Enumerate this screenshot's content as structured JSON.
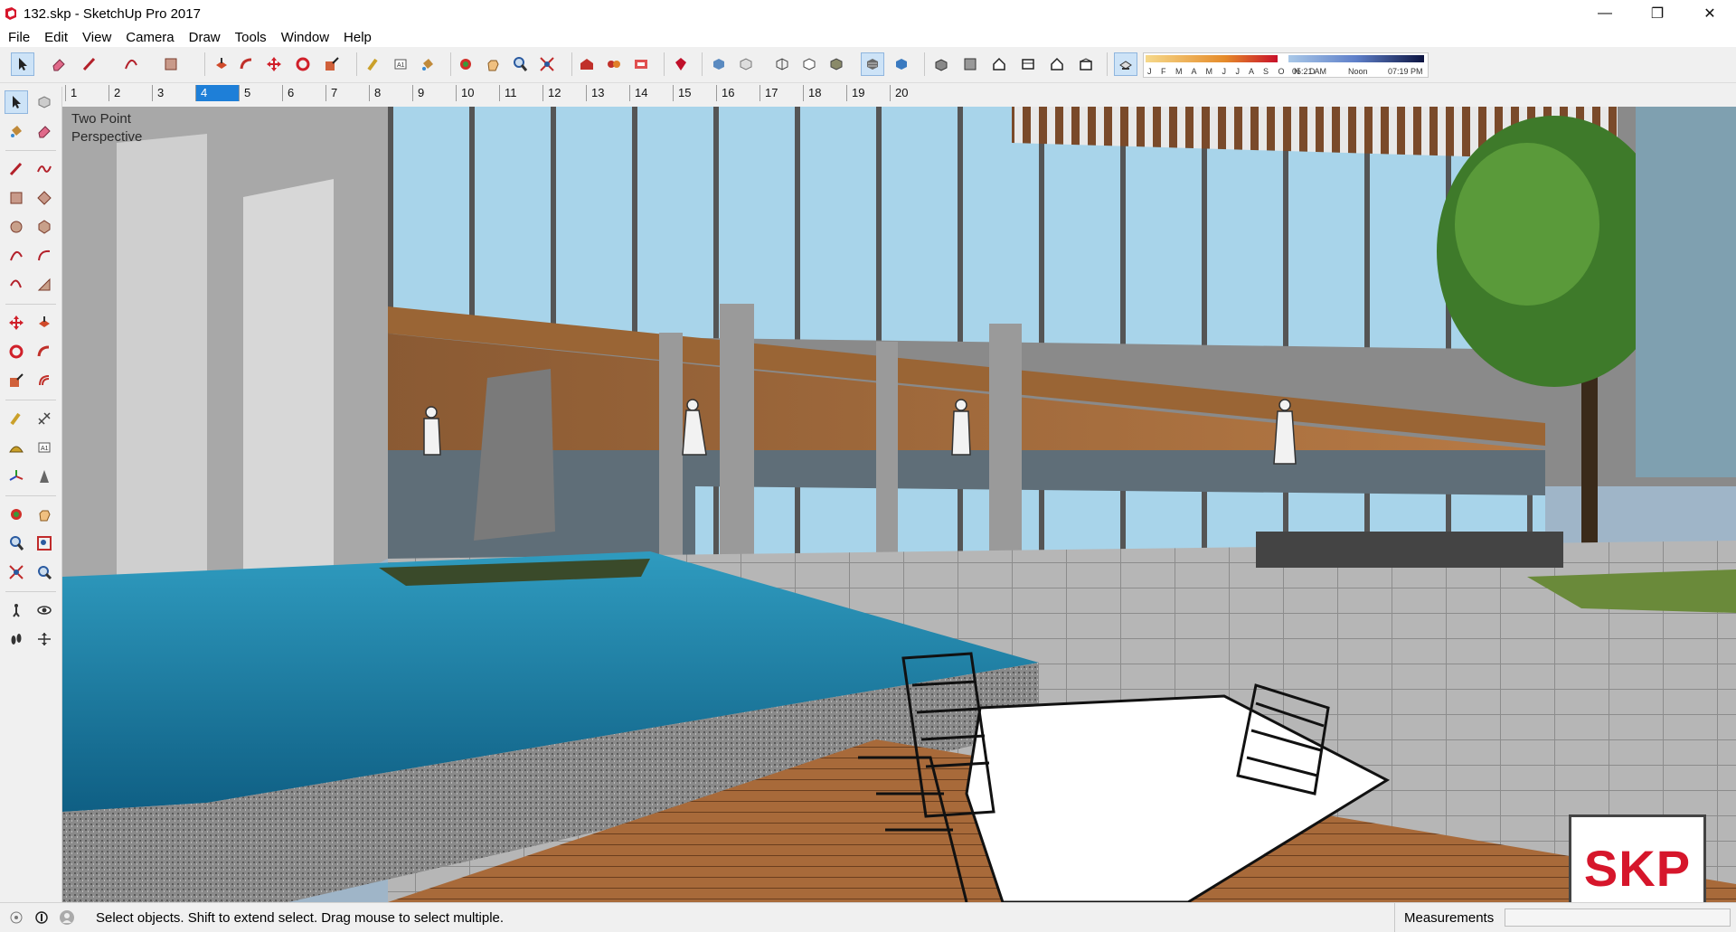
{
  "window": {
    "title": "132.skp - SketchUp Pro 2017",
    "minimize_glyph": "—",
    "restore_glyph": "❐",
    "close_glyph": "✕"
  },
  "menu": [
    "File",
    "Edit",
    "View",
    "Camera",
    "Draw",
    "Tools",
    "Window",
    "Help"
  ],
  "toolbar": {
    "shadow_months": "J F M A M J J A S O N D",
    "time_start": "05:21 AM",
    "time_noon": "Noon",
    "time_end": "07:19 PM",
    "icons": [
      "select-icon",
      "eraser-icon",
      "line-icon",
      "arc-icon",
      "rectangle-icon",
      "push-pull-icon",
      "follow-me-icon",
      "move-icon",
      "rotate-icon",
      "scale-icon",
      "tape-measure-icon",
      "text-icon",
      "paint-bucket-icon",
      "orbit-icon",
      "pan-icon",
      "zoom-icon",
      "zoom-extents-icon",
      "warehouse-icon",
      "extension-icon",
      "layout-icon",
      "ruby-icon",
      "xray-icon",
      "back-edges-icon",
      "wireframe-icon",
      "hidden-line-icon",
      "shaded-icon",
      "shaded-textures-icon",
      "monochrome-icon",
      "iso-view-icon",
      "top-view-icon",
      "front-view-icon",
      "right-view-icon",
      "back-view-icon",
      "left-view-icon",
      "shadows-toggle-icon"
    ]
  },
  "scenes": [
    "1",
    "2",
    "3",
    "4",
    "5",
    "6",
    "7",
    "8",
    "9",
    "10",
    "11",
    "12",
    "13",
    "14",
    "15",
    "16",
    "17",
    "18",
    "19",
    "20"
  ],
  "selected_scene": "4",
  "viewport": {
    "label_line1": "Two Point",
    "label_line2": "Perspective",
    "logo_text": "SKP"
  },
  "status": {
    "hint": "Select objects. Shift to extend select. Drag mouse to select multiple.",
    "measurements_label": "Measurements",
    "measurements_value": ""
  },
  "colors": {
    "accent": "#1e7fd8",
    "logo_red": "#d6162b"
  }
}
